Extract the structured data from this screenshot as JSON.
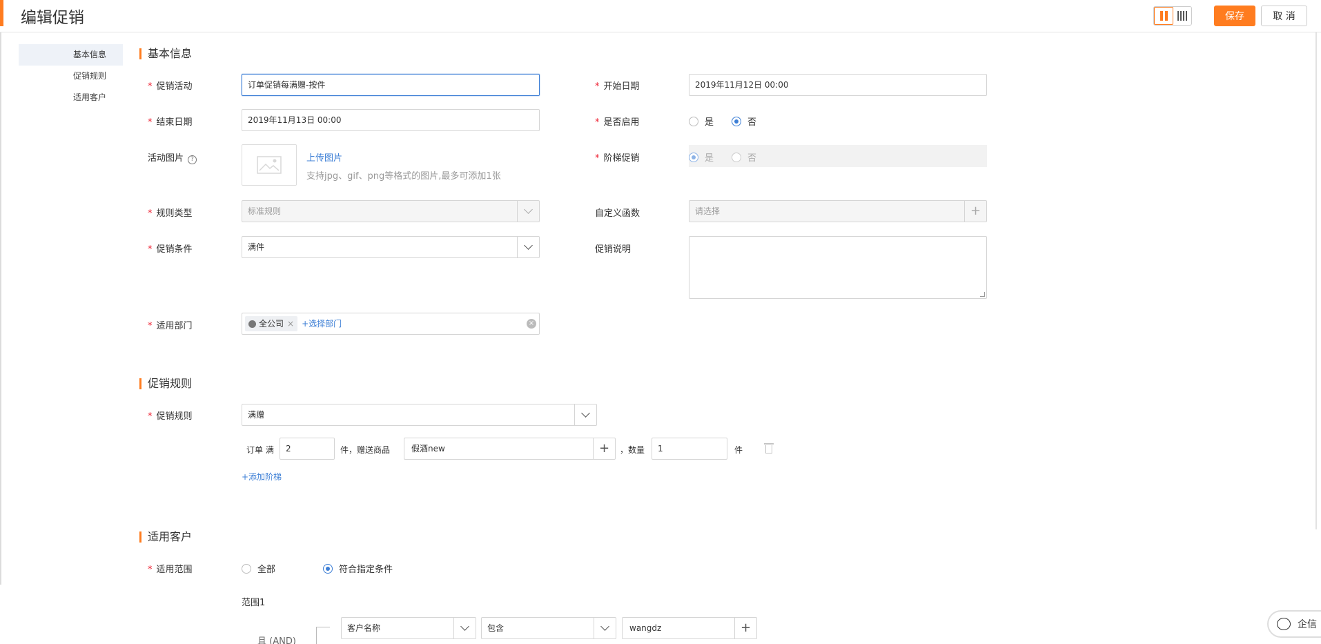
{
  "header": {
    "title": "编辑促销",
    "save_label": "保存",
    "cancel_label": "取 消"
  },
  "sidenav": {
    "items": [
      "基本信息",
      "促销规则",
      "适用客户"
    ]
  },
  "basic": {
    "section_title": "基本信息",
    "promo_activity_label": "促销活动",
    "promo_activity_value": "订单促销每满赠-按件",
    "start_date_label": "开始日期",
    "start_date_value": "2019年11月12日 00:00",
    "end_date_label": "结束日期",
    "end_date_value": "2019年11月13日 00:00",
    "enabled_label": "是否启用",
    "yes": "是",
    "no": "否",
    "image_label": "活动图片",
    "upload_link": "上传图片",
    "upload_hint": "支持jpg、gif、png等格式的图片,最多可添加1张",
    "tiered_label": "阶梯促销",
    "rule_type_label": "规则类型",
    "rule_type_value": "标准规则",
    "custom_fn_label": "自定义函数",
    "custom_fn_placeholder": "请选择",
    "condition_label": "促销条件",
    "condition_value": "满件",
    "description_label": "促销说明",
    "dept_label": "适用部门",
    "dept_tag": "全公司",
    "dept_add": "+选择部门"
  },
  "rules": {
    "section_title": "促销规则",
    "rule_label": "促销规则",
    "rule_value": "满赠",
    "order_full": "订单 满",
    "threshold": "2",
    "unit_gift": "件，赠送商品",
    "gift_product": "假酒new",
    "qty_label": "，数量",
    "qty_value": "1",
    "unit": "件",
    "add_tier": "+添加阶梯"
  },
  "customers": {
    "section_title": "适用客户",
    "scope_label": "适用范围",
    "all": "全部",
    "specified": "符合指定条件",
    "range_title": "范围1",
    "and_label": "且 (AND)",
    "field_name": "客户名称",
    "operator": "包含",
    "value": "wangdz"
  },
  "widget": {
    "qixin": "企信"
  },
  "colors": {
    "accent": "#ff7c1f",
    "link": "#3d7fd6"
  }
}
